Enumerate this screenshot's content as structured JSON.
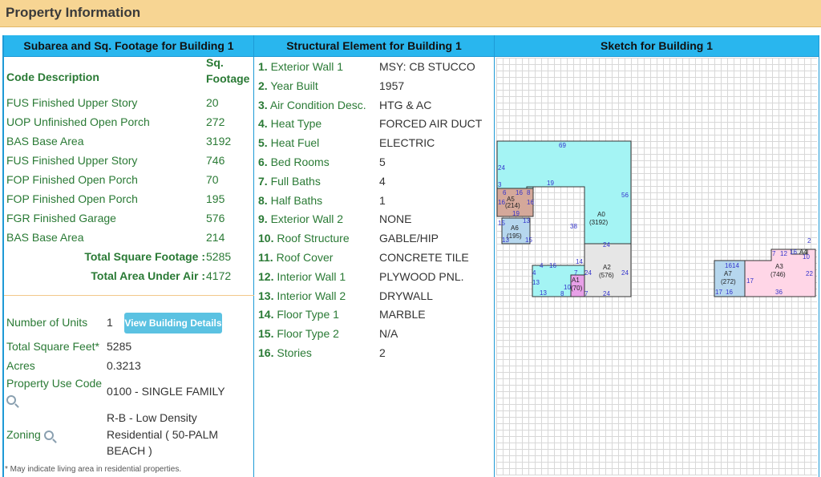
{
  "page_title": "Property Information",
  "subarea": {
    "heading": "Subarea and Sq. Footage for Building 1",
    "col_code": "Code Description",
    "col_sqft_line1": "Sq.",
    "col_sqft_line2": "Footage",
    "rows": [
      {
        "code": "FUS Finished Upper Story",
        "sqft": "20"
      },
      {
        "code": "UOP Unfinished Open Porch",
        "sqft": "272"
      },
      {
        "code": "BAS Base Area",
        "sqft": "3192"
      },
      {
        "code": "FUS Finished Upper Story",
        "sqft": "746"
      },
      {
        "code": "FOP Finished Open Porch",
        "sqft": "70"
      },
      {
        "code": "FOP Finished Open Porch",
        "sqft": "195"
      },
      {
        "code": "FGR Finished Garage",
        "sqft": "576"
      },
      {
        "code": "BAS Base Area",
        "sqft": "214"
      }
    ],
    "total_sqft_label": "Total Square Footage :",
    "total_sqft_value": "5285",
    "total_area_label": "Total Area Under Air :",
    "total_area_value": "4172"
  },
  "property": {
    "units_label": "Number of Units",
    "units_value": "1",
    "view_button": "View Building Details",
    "total_sqft_label": "Total Square Feet*",
    "total_sqft_value": "5285",
    "acres_label": "Acres",
    "acres_value": "0.3213",
    "use_code_label": "Property Use Code",
    "use_code_value": "0100 - SINGLE FAMILY",
    "zoning_label": "Zoning",
    "zoning_line1": "R-B - Low Density",
    "zoning_line2": "Residential ( 50-PALM",
    "zoning_line3": "BEACH )",
    "footnote": "* May indicate living area in residential properties."
  },
  "structure": {
    "heading": "Structural Element for Building 1",
    "items": [
      {
        "num": "1.",
        "label": "Exterior Wall 1",
        "value": "MSY: CB STUCCO"
      },
      {
        "num": "2.",
        "label": "Year Built",
        "value": "1957"
      },
      {
        "num": "3.",
        "label": "Air Condition Desc.",
        "value": "HTG & AC"
      },
      {
        "num": "4.",
        "label": "Heat Type",
        "value": "FORCED AIR DUCT"
      },
      {
        "num": "5.",
        "label": "Heat Fuel",
        "value": "ELECTRIC"
      },
      {
        "num": "6.",
        "label": "Bed Rooms",
        "value": "5"
      },
      {
        "num": "7.",
        "label": "Full Baths",
        "value": "4"
      },
      {
        "num": "8.",
        "label": "Half Baths",
        "value": "1"
      },
      {
        "num": "9.",
        "label": "Exterior Wall 2",
        "value": "NONE"
      },
      {
        "num": "10.",
        "label": "Roof Structure",
        "value": "GABLE/HIP"
      },
      {
        "num": "11.",
        "label": "Roof Cover",
        "value": "CONCRETE TILE"
      },
      {
        "num": "12.",
        "label": "Interior Wall 1",
        "value": "PLYWOOD PNL."
      },
      {
        "num": "13.",
        "label": "Interior Wall 2",
        "value": "DRYWALL"
      },
      {
        "num": "14.",
        "label": "Floor Type 1",
        "value": "MARBLE"
      },
      {
        "num": "15.",
        "label": "Floor Type 2",
        "value": "N/A"
      },
      {
        "num": "16.",
        "label": "Stories",
        "value": "2"
      }
    ]
  },
  "sketch": {
    "heading": "Sketch for Building 1",
    "labels": {
      "a0": "A0",
      "a0_area": "(3192)",
      "a2": "A2",
      "a2_area": "(576)",
      "a3": "A3",
      "a3_area": "(746)",
      "a6": "A6",
      "a6_area": "(195)",
      "a7": "A7",
      "a7_area": "(272)",
      "a1": "A1",
      "a1_area": "(70)",
      "a5": "A5",
      "a5_area": "(214)",
      "a4": "A4"
    },
    "colors": {
      "base": "#a4f4f4",
      "garage": "#e6e6e6",
      "upper": "#ffd6e7",
      "porch": "#b6d7ee",
      "small": "#e8a0e8",
      "brown": "#d4a89a"
    }
  }
}
